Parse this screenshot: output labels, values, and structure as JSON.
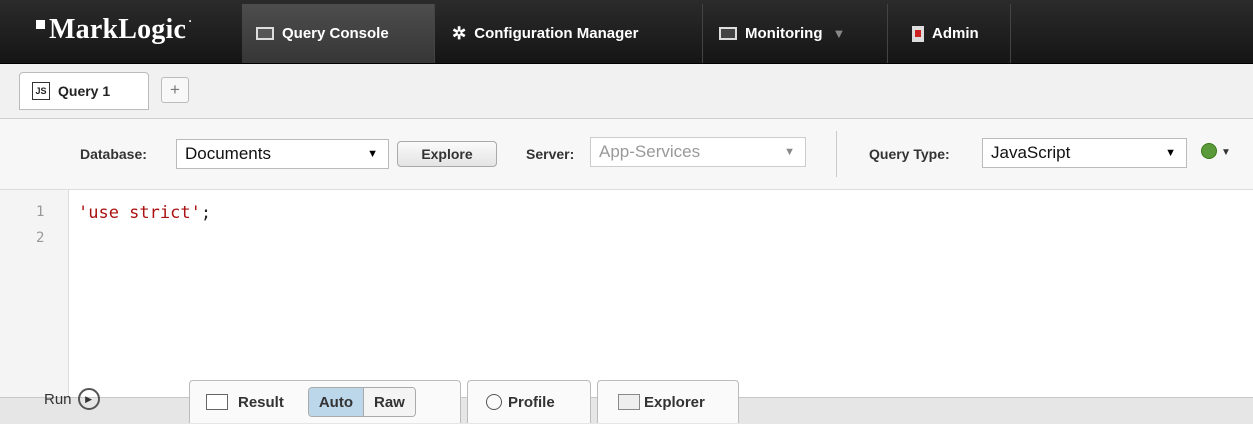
{
  "nav": {
    "logo": "MarkLogic",
    "logo_mark": "·",
    "tabs": [
      {
        "label": "Query Console",
        "icon": "console-icon",
        "active": true
      },
      {
        "label": "Configuration Manager",
        "icon": "gear-icon"
      },
      {
        "label": "Monitoring",
        "icon": "monitor-icon",
        "caret": "▼"
      },
      {
        "label": "Admin",
        "icon": "admin-icon"
      }
    ]
  },
  "query_tabs": {
    "items": [
      {
        "label": "Query 1",
        "badge": "JS"
      }
    ],
    "add": "+"
  },
  "settings": {
    "database_label": "Database:",
    "database_value": "Documents",
    "explore_label": "Explore",
    "server_label": "Server:",
    "server_value": "App-Services",
    "query_type_label": "Query Type:",
    "query_type_value": "JavaScript",
    "arrow": "▼"
  },
  "editor": {
    "line_numbers": [
      "1",
      "2"
    ],
    "line1_string": "'use strict'",
    "line1_punct": ";"
  },
  "bottom": {
    "run_label": "Run",
    "run_icon": "▶",
    "result_label": "Result",
    "auto_label": "Auto",
    "raw_label": "Raw",
    "profile_label": "Profile",
    "explorer_label": "Explorer"
  },
  "colors": {
    "nav_bg": "#1f1f1f",
    "string": "#aa1111",
    "toggle_on": "#bcd7ea"
  }
}
